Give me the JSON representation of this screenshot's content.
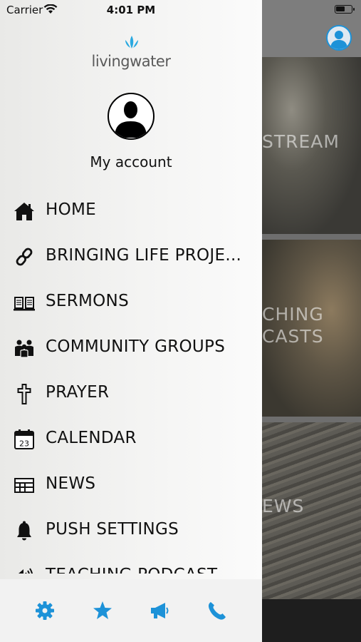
{
  "status_bar": {
    "carrier": "Carrier",
    "time": "4:01 PM"
  },
  "drawer": {
    "logo_text": "livingwater",
    "account_label": "My account",
    "menu": [
      {
        "label": "HOME",
        "icon": "home-icon"
      },
      {
        "label": "BRINGING LIFE PROJE...",
        "icon": "link-icon"
      },
      {
        "label": "SERMONS",
        "icon": "book-icon"
      },
      {
        "label": "COMMUNITY GROUPS",
        "icon": "group-icon"
      },
      {
        "label": "PRAYER",
        "icon": "cross-icon"
      },
      {
        "label": "CALENDAR",
        "icon": "calendar-icon",
        "icon_text": "23"
      },
      {
        "label": "NEWS",
        "icon": "news-icon"
      },
      {
        "label": "PUSH SETTINGS",
        "icon": "bell-icon"
      },
      {
        "label": "TEACHING PODCAST",
        "icon": "speaker-icon"
      }
    ],
    "bottom_bar": [
      {
        "icon": "gear-icon"
      },
      {
        "icon": "star-icon"
      },
      {
        "icon": "megaphone-icon"
      },
      {
        "icon": "phone-icon"
      }
    ]
  },
  "background": {
    "tiles": [
      {
        "label": "STREAM"
      },
      {
        "label_line1": "CHING",
        "label_line2": "CASTS"
      },
      {
        "label": "EWS"
      }
    ]
  },
  "colors": {
    "accent": "#1d92d8",
    "logo_drops": "#2aa9e0",
    "text": "#111111"
  }
}
